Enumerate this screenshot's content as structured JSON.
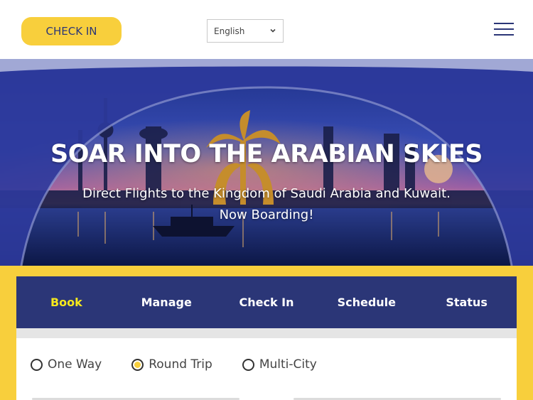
{
  "header": {
    "checkin_label": "CHECK IN",
    "language": {
      "selected": "English"
    }
  },
  "hero": {
    "title": "SOAR INTO THE ARABIAN SKIES",
    "subtitle_line1": "Direct Flights to the Kingdom of Saudi Arabia and Kuwait.",
    "subtitle_line2": "Now Boarding!"
  },
  "booking": {
    "tabs": [
      {
        "label": "Book",
        "active": true
      },
      {
        "label": "Manage",
        "active": false
      },
      {
        "label": "Check In",
        "active": false
      },
      {
        "label": "Schedule",
        "active": false
      },
      {
        "label": "Status",
        "active": false
      }
    ],
    "trip_types": [
      {
        "label": "One Way",
        "selected": false
      },
      {
        "label": "Round Trip",
        "selected": true
      },
      {
        "label": "Multi-City",
        "selected": false
      }
    ]
  },
  "colors": {
    "brand_yellow": "#f8cf3c",
    "brand_navy": "#2b3677",
    "active_tab_text": "#f5e81d"
  },
  "icons": {
    "menu": "hamburger-menu-icon",
    "dropdown": "chevron-down-icon"
  }
}
